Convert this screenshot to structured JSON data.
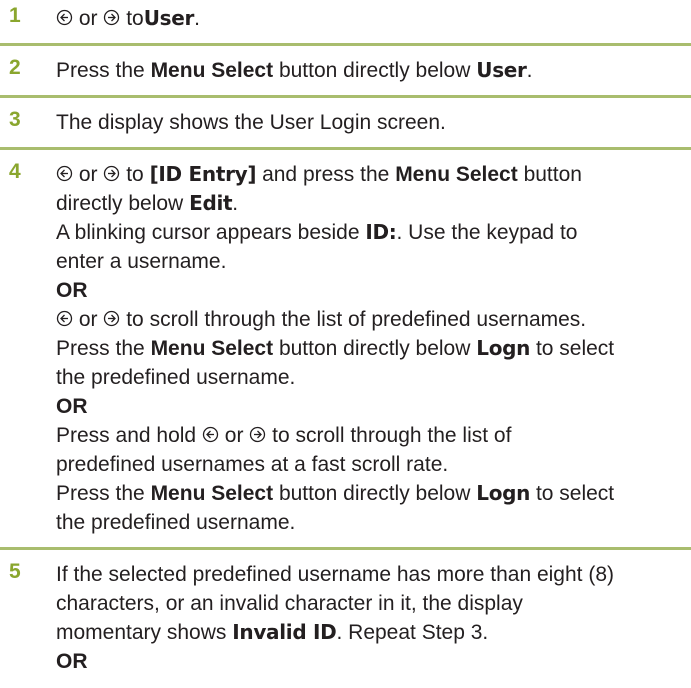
{
  "step_accent_color": "#8aa62e",
  "divider_color": "#a9bd6e",
  "icons": {
    "left": "left-arrow-key-icon",
    "right": "right-arrow-key-icon"
  },
  "steps": [
    {
      "num": "1",
      "or": "or",
      "to": "to",
      "target": "User",
      "end": "."
    },
    {
      "num": "2",
      "pre": "Press the",
      "btn": "Menu Select",
      "post": "button directly below",
      "target": "User",
      "end": "."
    },
    {
      "num": "3",
      "text": "The display shows the User Login screen."
    },
    {
      "num": "4",
      "l1_or": "or",
      "l1_to": "to",
      "l1_target": "[ID Entry]",
      "l1_and": "and press the",
      "l1_btn": "Menu Select",
      "l1_post": "button",
      "l2_pre": "directly below",
      "l2_target": "Edit",
      "l2_end": ".",
      "l3_pre": "A blinking cursor appears beside",
      "l3_target": "ID:",
      "l3_post": ". Use the keypad to",
      "l4": "enter a username.",
      "or1": "OR",
      "l6_or": "or",
      "l6_post": "to scroll through the list of predefined usernames.",
      "l7_pre": "Press the",
      "l7_btn": "Menu Select",
      "l7_mid": "button directly below",
      "l7_target": "Logn",
      "l7_post": "to select",
      "l8": "the predefined username.",
      "or2": "OR",
      "l10_pre": "Press and hold",
      "l10_or": "or",
      "l10_post": "to scroll through the list of",
      "l11": "predefined usernames at a fast scroll rate.",
      "l12_pre": "Press the",
      "l12_btn": "Menu Select",
      "l12_mid": "button directly below",
      "l12_target": "Logn",
      "l12_post": "to select",
      "l13": "the predefined username."
    },
    {
      "num": "5",
      "l1": "If the selected predefined username has more than eight (8)",
      "l2": "characters, or an invalid character in it, the display",
      "l3_pre": "momentary shows",
      "l3_target": "Invalid ID",
      "l3_post": ". Repeat Step 3.",
      "or": "OR"
    }
  ]
}
